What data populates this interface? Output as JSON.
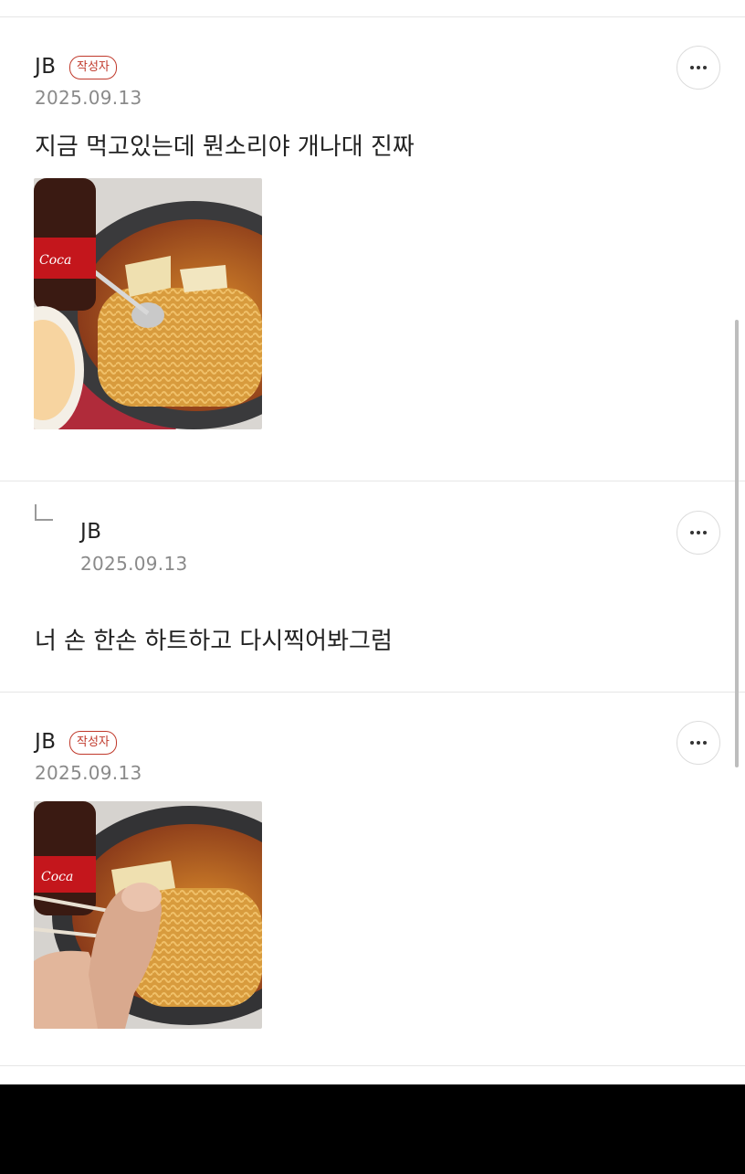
{
  "comments": [
    {
      "author": "JB",
      "badge": "작성자",
      "date": "2025.09.13",
      "text": "지금 먹고있는데 뭔소리야 개나대 진짜",
      "photo": "ramen-with-cola-photo"
    },
    {
      "author": "JB",
      "date": "2025.09.13",
      "text": "너 손 한손 하트하고 다시찍어봐그럼"
    },
    {
      "author": "JB",
      "badge": "작성자",
      "date": "2025.09.13",
      "photo": "ramen-finger-heart-photo"
    }
  ],
  "icons": {
    "more": "more-horizontal-icon",
    "reply": "reply-arrow-icon"
  },
  "colors": {
    "badge": "#c0392b",
    "date": "#8a8a8a",
    "divider": "#e6e6e6"
  }
}
